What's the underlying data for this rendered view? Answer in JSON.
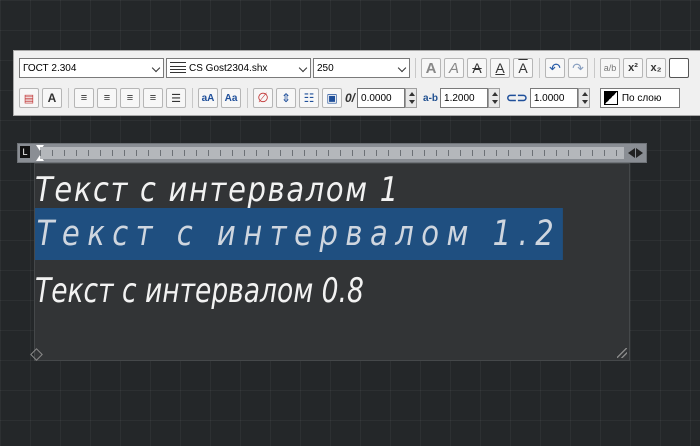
{
  "toolbar": {
    "style_combo": "ГОСТ 2.304",
    "font_combo": "CS  Gost2304.shx",
    "height_combo": "250",
    "oblique_value": "0.0000",
    "tracking_label": "a-b",
    "tracking_value": "1.2000",
    "width_value": "1.0000",
    "color_combo": "По слою",
    "superscript_label": "x²",
    "subscript_label": "x₂",
    "stack_label": "a/b",
    "oblique_label": "0/",
    "case_upper_label": "aA",
    "case_lower_label": "Aa"
  },
  "editor": {
    "lines": [
      "Текст с интервалом 1",
      "Текст с интервалом 1.2",
      "Текст с интервалом 0.8"
    ]
  },
  "colors": {
    "background": "#242729",
    "editor_bg": "#323436",
    "selection": "#1f4f80",
    "text": "#f2f2f2"
  },
  "icons": [
    "bold-icon",
    "italic-icon",
    "strikethrough-icon",
    "underline-icon",
    "overline-icon",
    "undo-icon",
    "redo-icon",
    "stack-icon",
    "superscript-icon",
    "subscript-icon",
    "columns-icon",
    "mtext-justify-icon",
    "align-left-icon",
    "align-center-icon",
    "align-right-icon",
    "justify-icon",
    "distribute-icon",
    "uppercase-icon",
    "lowercase-icon",
    "symbol-icon",
    "paragraph-icon",
    "numbering-icon",
    "insert-field-icon",
    "oblique-icon",
    "tracking-icon",
    "width-factor-icon",
    "color-swatch-icon"
  ]
}
